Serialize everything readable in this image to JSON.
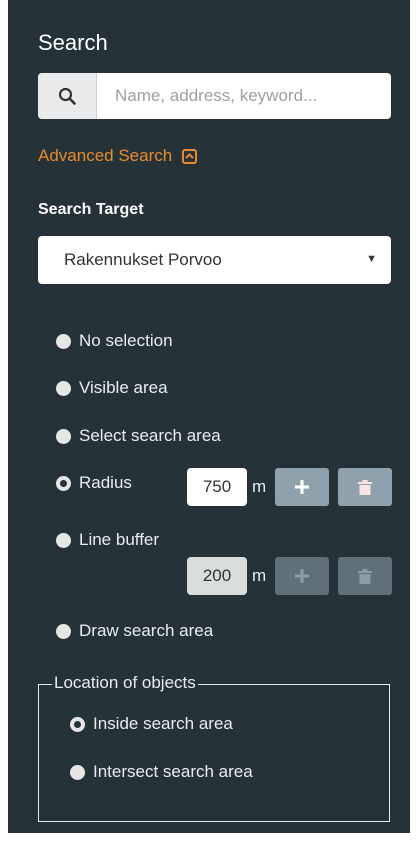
{
  "search": {
    "title": "Search",
    "placeholder": "Name, address, keyword..."
  },
  "advanced": {
    "label": "Advanced Search"
  },
  "target": {
    "label": "Search Target",
    "selected": "Rakennukset Porvoo"
  },
  "area_options": [
    {
      "label": "No selection",
      "checked": false
    },
    {
      "label": "Visible area",
      "checked": false
    },
    {
      "label": "Select search area",
      "checked": false
    },
    {
      "label": "Radius",
      "checked": true
    },
    {
      "label": "Line buffer",
      "checked": false
    },
    {
      "label": "Draw search area",
      "checked": false
    }
  ],
  "radius": {
    "value": "750",
    "unit": "m"
  },
  "buffer": {
    "value": "200",
    "unit": "m"
  },
  "location": {
    "legend": "Location of objects",
    "options": [
      {
        "label": "Inside search area",
        "checked": true
      },
      {
        "label": "Intersect search area",
        "checked": false
      }
    ]
  },
  "colors": {
    "panel_bg": "#253238",
    "accent": "#e98a2d",
    "button_enabled": "#8fa1ab",
    "button_disabled": "#5f7079"
  },
  "icons": {
    "search": "search-icon",
    "collapse": "chevron-up-icon",
    "dropdown": "caret-down-icon",
    "add": "plus-icon",
    "delete": "trash-icon"
  }
}
